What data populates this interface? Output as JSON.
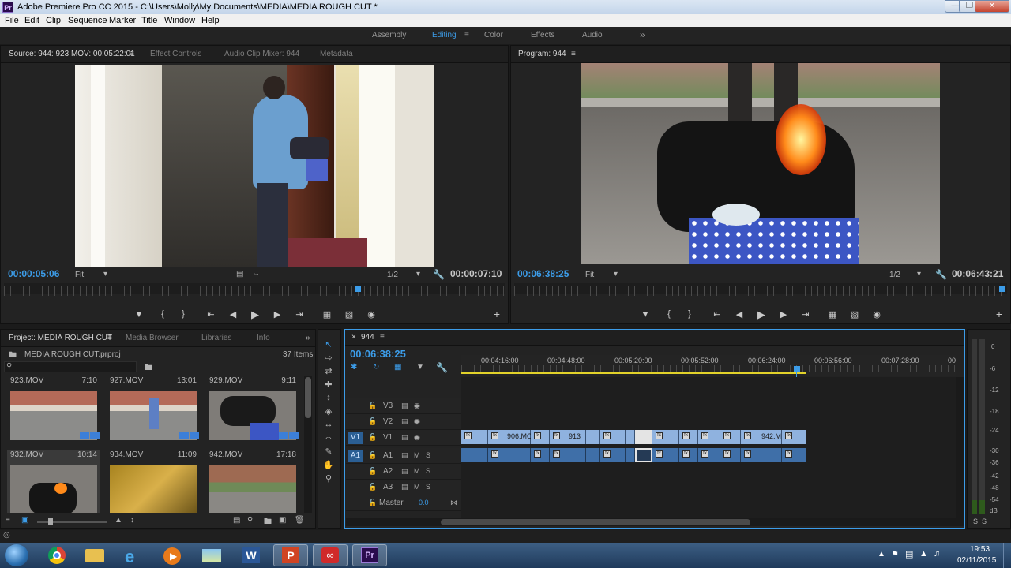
{
  "window": {
    "title": "Adobe Premiere Pro CC 2015 - C:\\Users\\Molly\\My Documents\\MEDIA\\MEDIA ROUGH CUT *",
    "logo": "Pr"
  },
  "menu": [
    "File",
    "Edit",
    "Clip",
    "Sequence",
    "Marker",
    "Title",
    "Window",
    "Help"
  ],
  "workspaces": {
    "items": [
      "Assembly",
      "Editing",
      "Color",
      "Effects",
      "Audio"
    ],
    "active": "Editing",
    "more": "»"
  },
  "source": {
    "tabs": [
      "Source: 944: 923.MOV: 00:05:22:01",
      "Effect Controls",
      "Audio Clip Mixer: 944",
      "Metadata"
    ],
    "timecode_left": "00:00:05:06",
    "timecode_right": "00:00:07:10",
    "fit": "Fit",
    "resolution": "1/2"
  },
  "program": {
    "tab": "Program: 944",
    "timecode_left": "00:06:38:25",
    "timecode_right": "00:06:43:21",
    "fit": "Fit",
    "resolution": "1/2"
  },
  "project": {
    "tabs": [
      "Project: MEDIA ROUGH CUT",
      "Media Browser",
      "Libraries",
      "Info"
    ],
    "file": "MEDIA ROUGH CUT.prproj",
    "count": "37 Items",
    "items": [
      {
        "name": "923.MOV",
        "duration": "7:10"
      },
      {
        "name": "927.MOV",
        "duration": "13:01"
      },
      {
        "name": "929.MOV",
        "duration": "9:11"
      },
      {
        "name": "932.MOV",
        "duration": "10:14"
      },
      {
        "name": "934.MOV",
        "duration": "11:09"
      },
      {
        "name": "942.MOV",
        "duration": "17:18"
      }
    ]
  },
  "timeline": {
    "tab": "944",
    "timecode": "00:06:38:25",
    "ruler": [
      "00:04:16:00",
      "00:04:48:00",
      "00:05:20:00",
      "00:05:52:00",
      "00:06:24:00",
      "00:06:56:00",
      "00:07:28:00",
      "00"
    ],
    "tracks": {
      "video": [
        "V3",
        "V2",
        "V1"
      ],
      "audio": [
        "A1",
        "A2",
        "A3"
      ],
      "master": "Master",
      "master_value": "0.0",
      "source_v": "V1",
      "source_a": "A1",
      "m": "M",
      "s": "S"
    },
    "clip_labels": [
      "906.MO",
      "913",
      "942.M"
    ]
  },
  "meter": {
    "scale": [
      "0",
      "-6",
      "-12",
      "-18",
      "-24",
      "-30",
      "-36",
      "-42",
      "-48",
      "-54"
    ],
    "unit": "dB",
    "solo": [
      "S",
      "S"
    ]
  },
  "taskbar": {
    "time": "19:53",
    "date": "02/11/2015"
  },
  "colors": {
    "accent": "#3c9ce8",
    "video_clip": "#8fb2df",
    "audio_clip": "#3f6fa8"
  }
}
